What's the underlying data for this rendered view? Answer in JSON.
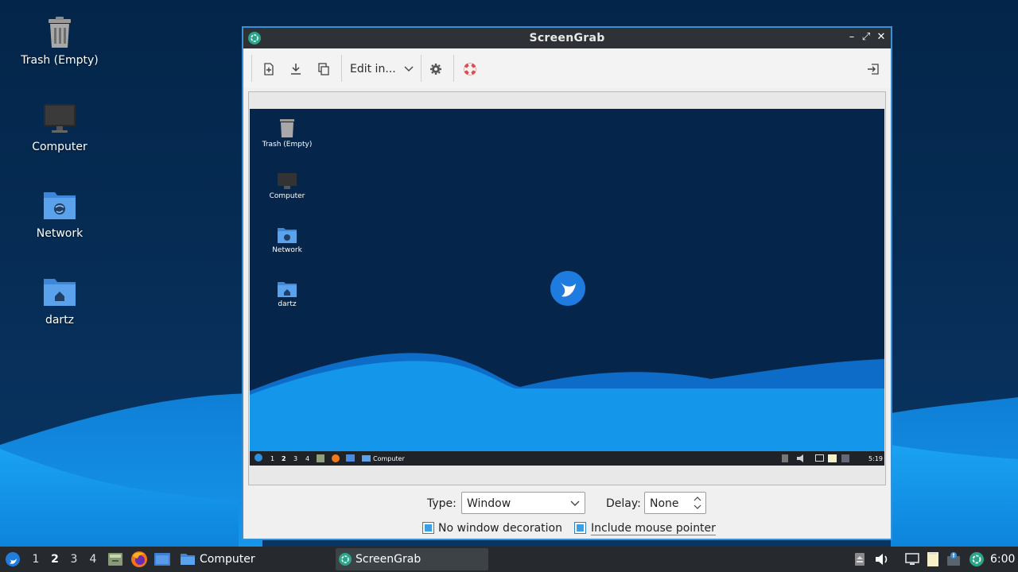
{
  "desktop": {
    "icons": [
      {
        "label": "Trash (Empty)",
        "icon": "trash-icon"
      },
      {
        "label": "Computer",
        "icon": "computer-icon"
      },
      {
        "label": "Network",
        "icon": "network-folder-icon"
      },
      {
        "label": "dartz",
        "icon": "home-folder-icon"
      }
    ]
  },
  "window": {
    "title": "ScreenGrab",
    "controls": {
      "minimize": "–",
      "maximize": "⤢",
      "close": "✕"
    },
    "toolbar": {
      "new_screenshot": "new-screenshot-icon",
      "save": "save-icon",
      "copy": "copy-icon",
      "edit_in_label": "Edit in...",
      "settings": "gear-icon",
      "help": "lifebuoy-icon",
      "exit": "exit-icon"
    },
    "preview": {
      "icons": [
        "Trash (Empty)",
        "Computer",
        "Network",
        "dartz"
      ],
      "taskbar": {
        "workspaces": [
          "1",
          "2",
          "3",
          "4"
        ],
        "task": "Computer",
        "clock": "5:19"
      }
    },
    "options": {
      "type_label": "Type:",
      "type_value": "Window",
      "delay_label": "Delay:",
      "delay_value": "None",
      "no_decoration_label": "No window decoration",
      "include_pointer_label": "Include mouse pointer",
      "no_decoration_checked": true,
      "include_pointer_checked": true
    }
  },
  "taskbar": {
    "workspaces": [
      "1",
      "2",
      "3",
      "4"
    ],
    "active_workspace": "2",
    "tasks": [
      {
        "label": "Computer",
        "icon": "folder-icon",
        "active": false
      },
      {
        "label": "ScreenGrab",
        "icon": "screengrab-icon",
        "active": true
      }
    ],
    "clock": "6:00"
  },
  "colors": {
    "accent": "#3a8fd5",
    "wallpaper_dark": "#06284c",
    "wave_light": "#1e9cf0",
    "taskbar": "#262a2e"
  }
}
